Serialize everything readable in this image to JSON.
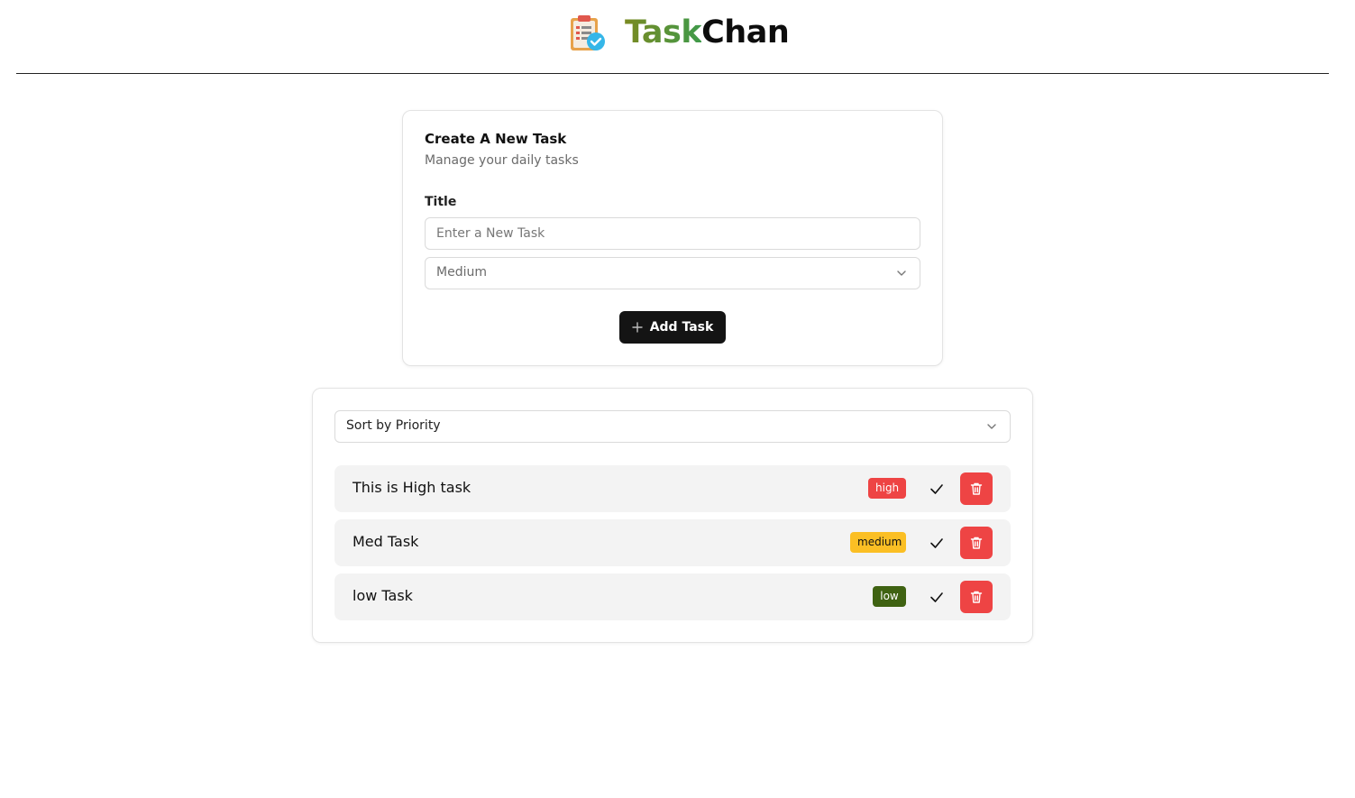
{
  "app": {
    "brand_part1": "Task",
    "brand_part2": "Chan",
    "logo_icon": "clipboard-check-icon"
  },
  "create": {
    "title": "Create A New Task",
    "subtitle": "Manage your daily tasks",
    "field_label": "Title",
    "title_placeholder": "Enter a New Task",
    "priority_selected": "Medium",
    "add_button_label": "Add Task"
  },
  "list": {
    "sort_selected": "Sort by Priority",
    "tasks": [
      {
        "title": "This is High task",
        "priority": "high",
        "badge_bg": "#ee4444",
        "badge_fg": "#ffffff"
      },
      {
        "title": "Med Task",
        "priority": "medium",
        "badge_bg": "#fbbf24",
        "badge_fg": "#111111"
      },
      {
        "title": "low Task",
        "priority": "low",
        "badge_bg": "#3f6212",
        "badge_fg": "#ffffff"
      }
    ]
  },
  "colors": {
    "accent_dark": "#141414",
    "danger": "#ee4444"
  }
}
